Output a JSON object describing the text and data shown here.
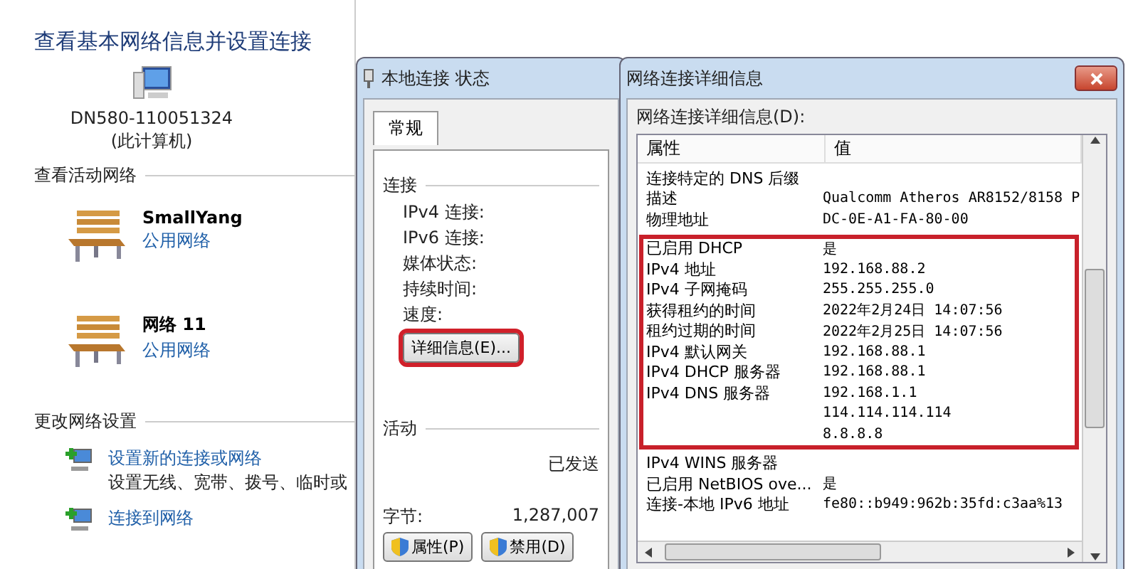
{
  "network_center": {
    "title": "查看基本网络信息并设置连接",
    "computer": {
      "name": "DN580-110051324",
      "note": "(此计算机)"
    },
    "active_networks": {
      "heading": "查看活动网络",
      "items": [
        {
          "name": "SmallYang",
          "type": "公用网络"
        },
        {
          "name": "网络  11",
          "type": "公用网络"
        }
      ]
    },
    "change_settings": {
      "heading": "更改网络设置",
      "items": [
        {
          "link": "设置新的连接或网络",
          "description": "设置无线、宽带、拨号、临时或"
        },
        {
          "link": "连接到网络"
        }
      ]
    }
  },
  "status_dialog": {
    "title": "本地连接 状态",
    "tabs": [
      {
        "label": "常规",
        "selected": true
      }
    ],
    "connection": {
      "heading": "连接",
      "fields": [
        "IPv4 连接:",
        "IPv6 连接:",
        "媒体状态:",
        "持续时间:",
        "速度:"
      ],
      "details_button": {
        "label": "详细信息(E)...",
        "highlighted": true
      }
    },
    "activity": {
      "heading": "活动",
      "sent_label": "已发送",
      "bytes_label": "字节:",
      "bytes_value": "1,287,007"
    },
    "buttons": [
      "属性(P)",
      "禁用(D)"
    ]
  },
  "details_dialog": {
    "title": "网络连接详细信息",
    "list_label": "网络连接详细信息(D):",
    "columns": [
      "属性",
      "值"
    ],
    "row_groups": [
      {
        "highlighted": false,
        "rows": [
          {
            "property": "连接特定的 DNS 后缀",
            "value": ""
          },
          {
            "property": "描述",
            "value": "Qualcomm Atheros AR8152/8158 P"
          },
          {
            "property": "物理地址",
            "value": "DC-0E-A1-FA-80-00"
          }
        ]
      },
      {
        "highlighted": true,
        "rows": [
          {
            "property": "已启用 DHCP",
            "value": "是"
          },
          {
            "property": "IPv4 地址",
            "value": "192.168.88.2"
          },
          {
            "property": "IPv4 子网掩码",
            "value": "255.255.255.0"
          },
          {
            "property": "获得租约的时间",
            "value": "2022年2月24日 14:07:56"
          },
          {
            "property": "租约过期的时间",
            "value": "2022年2月25日 14:07:56"
          },
          {
            "property": "IPv4 默认网关",
            "value": "192.168.88.1"
          },
          {
            "property": "IPv4 DHCP 服务器",
            "value": "192.168.88.1"
          },
          {
            "property": "IPv4 DNS 服务器",
            "value": "192.168.1.1"
          },
          {
            "property": "",
            "value": "114.114.114.114"
          },
          {
            "property": "",
            "value": "8.8.8.8"
          }
        ]
      },
      {
        "highlighted": false,
        "rows": [
          {
            "property": "IPv4 WINS 服务器",
            "value": ""
          },
          {
            "property": "已启用 NetBIOS ove...",
            "value": "是"
          },
          {
            "property": "连接-本地 IPv6 地址",
            "value": "fe80::b949:962b:35fd:c3aa%13"
          }
        ]
      }
    ]
  }
}
